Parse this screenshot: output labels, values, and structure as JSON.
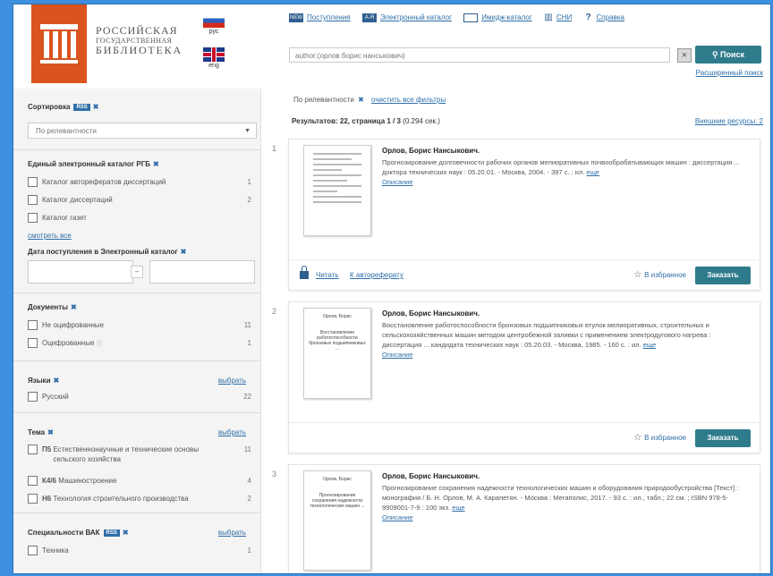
{
  "header": {
    "logo": {
      "line1": "РОССИЙСКАЯ",
      "line2": "ГОСУДАРСТВЕННАЯ",
      "line3": "БИБЛИОТЕКА"
    },
    "lang_ru": "рус",
    "lang_en": "eng",
    "links": [
      {
        "icon": "NEW",
        "label": "Поступления"
      },
      {
        "icon": "A-Я",
        "label": "Электронный каталог"
      },
      {
        "icon": "▭",
        "label": "Имидж-каталог"
      },
      {
        "icon": "▥",
        "label": "СНИ"
      },
      {
        "icon": "?",
        "label": "Справка"
      }
    ],
    "search_value": "author:(орлов борис нансыкович)",
    "search_clear": "×",
    "search_button": "Поиск",
    "advanced": "Расширенный поиск"
  },
  "sidebar": {
    "sort_title": "Сортировка",
    "sort_badge": "RSS",
    "sort_value": "По релевантности",
    "catalog_title": "Единый электронный каталог РГБ",
    "catalog_items": [
      {
        "label": "Каталог авторефератов диссертаций",
        "count": "1"
      },
      {
        "label": "Каталог диссертаций",
        "count": "2"
      },
      {
        "label": "Каталог газет",
        "count": ""
      }
    ],
    "show_all": "смотреть все",
    "date_title": "Дата поступления в Электронный каталог",
    "date_dash": "–",
    "docs_title": "Документы",
    "docs_items": [
      {
        "label": "Не оцифрованные",
        "count": "11"
      },
      {
        "label": "Оцифрованные",
        "count": "1"
      }
    ],
    "lang_title": "Языки",
    "choose": "выбрать",
    "lang_items": [
      {
        "label": "Русский",
        "count": "22"
      }
    ],
    "theme_title": "Тема",
    "theme_items": [
      {
        "code": "П5",
        "label": "Естественнонаучные и технические основы сельского хозяйства",
        "count": "11"
      },
      {
        "code": "К4/6",
        "label": "Машиностроение",
        "count": "4"
      },
      {
        "code": "Н6",
        "label": "Технология строительного производства",
        "count": "2"
      }
    ],
    "vak_title": "Специальности ВАК",
    "vak_badge": "RSS",
    "vak_items": [
      {
        "label": "Техника",
        "count": "1"
      }
    ]
  },
  "main": {
    "filter_chip": "По релевантности",
    "filter_x": "✖",
    "clear_filters": "очистить все фильтры",
    "results_label": "Результатов: 22, страница 1 / 3",
    "results_time": "(0.294 сек.)",
    "ext_resources": "Внешние ресурсы: 2",
    "results": [
      {
        "num": "1",
        "author": "Орлов, Борис Нансыкович.",
        "desc": "Прогнозирование долговечности рабочих органов мелиоративных почвообрабатывающих машин : диссертация ... доктора технических наук : 05.20.01. - Москва, 2004. - 397 с. : ил.",
        "more": "еще",
        "opisanie": "Описание",
        "read": "Читать",
        "to_abstract": "К автореферату",
        "fav": "В избранное",
        "order": "Заказать"
      },
      {
        "num": "2",
        "thumb_author": "Орлов, Борис",
        "thumb_title": "Восстановление работоспособности бронзовых подшипниковых ...",
        "author": "Орлов, Борис Нансыкович.",
        "desc": "Восстановление работоспособности бронзовых подшипниковых втулок мелиоративных, строительных и сельскохозяйственных машин методом центробежной заливки с применением электродугового нагрева : диссертация ... кандидата технических наук : 05.20.03. - Москва, 1985. - 160 с. : ил.",
        "more": "еще",
        "opisanie": "Описание",
        "fav": "В избранное",
        "order": "Заказать"
      },
      {
        "num": "3",
        "thumb_author": "Орлов, Борис",
        "thumb_title": "Прогнозирование сохранения надежности технологических машин ...",
        "author": "Орлов, Борис Нансыкович.",
        "desc": "Прогнозирование сохранения надежности технологических машин и оборудования природообустройства [Текст] : монография / Б. Н. Орлов, М. А. Карапетян. - Москва : Мегаполис, 2017. - 93 с. : ил., табл.; 22 см. ; ISBN 978-5-9909001-7-9 : 100 экз.",
        "more": "еще",
        "opisanie": "Описание"
      }
    ]
  }
}
